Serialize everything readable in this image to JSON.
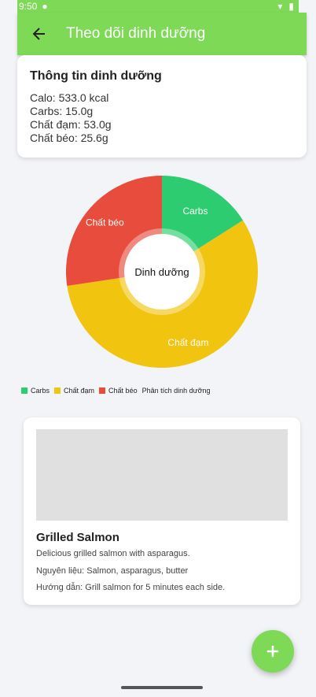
{
  "status_bar": {
    "time": "9:50"
  },
  "app_bar": {
    "title": "Theo dõi dinh dưỡng"
  },
  "nutrition_card": {
    "title": "Thông tin dinh dưỡng",
    "calories": "Calo: 533.0 kcal",
    "carbs": "Carbs: 15.0g",
    "protein": "Chất đạm: 53.0g",
    "fat": "Chất béo: 25.6g"
  },
  "chart_data": {
    "type": "pie",
    "center_label": "Dinh dưỡng",
    "categories": [
      "Carbs",
      "Chất đạm",
      "Chất béo"
    ],
    "values": [
      15.0,
      53.0,
      25.6
    ],
    "colors": [
      "#2ecc71",
      "#f1c40f",
      "#e74c3c"
    ],
    "legend_title": "Phân tích dinh dưỡng",
    "legend_position": "bottom-left"
  },
  "recipe": {
    "name": "Grilled Salmon",
    "description": "Delicious grilled salmon with asparagus.",
    "ingredients": "Nguyên liệu: Salmon, asparagus, butter",
    "instructions": "Hướng dẫn: Grill salmon for 5 minutes each side."
  },
  "fab": {
    "icon": "plus-icon"
  },
  "colors": {
    "primary": "#7ed957"
  }
}
